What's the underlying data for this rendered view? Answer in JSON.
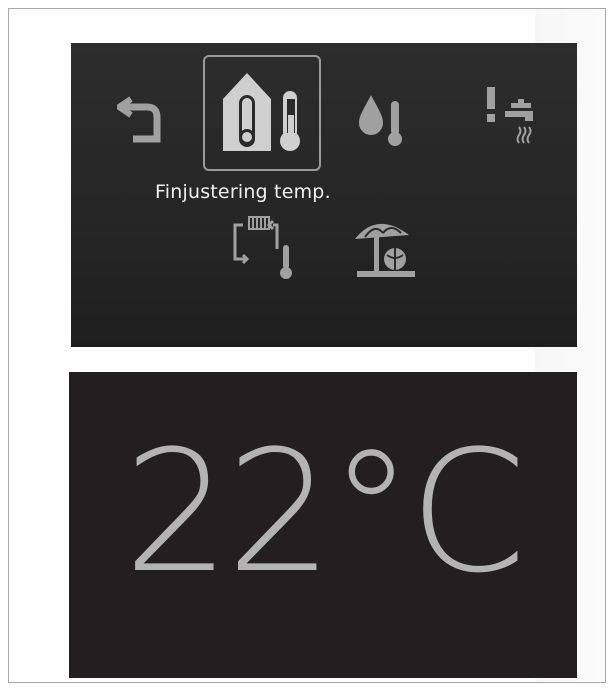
{
  "menu": {
    "selected_label": "Finjustering temp.",
    "icons": [
      {
        "name": "back-arrow-icon",
        "selected": false
      },
      {
        "name": "house-thermometer-icon",
        "selected": true
      },
      {
        "name": "water-drop-thermometer-icon",
        "selected": false
      },
      {
        "name": "hot-water-tap-alert-icon",
        "selected": false
      },
      {
        "name": "radiator-cycle-thermometer-icon",
        "selected": false
      },
      {
        "name": "beach-umbrella-holiday-icon",
        "selected": false
      }
    ]
  },
  "display": {
    "temperature": "22°C"
  },
  "colors": {
    "menu_background": "#2a2a2a",
    "temp_background": "#231f20",
    "icon_color": "#a0a0a0",
    "label_color": "#f0f0f0",
    "temp_text_color": "#b3b3b3",
    "selection_border": "#9a9a9a"
  }
}
